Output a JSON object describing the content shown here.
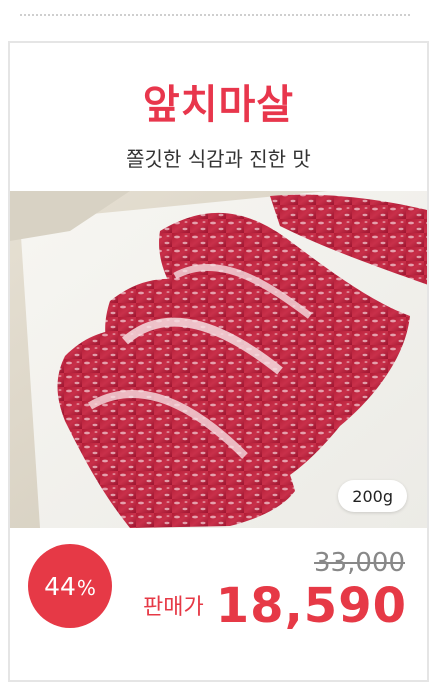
{
  "product": {
    "title": "앞치마살",
    "subtitle": "쫄깃한 식감과 진한 맛",
    "weight": "200g",
    "image_description_icon": "meat-photo"
  },
  "pricing": {
    "discount_value": "44",
    "discount_unit": "%",
    "price_label": "판매가",
    "original_price": "33,000",
    "sale_price": "18,590"
  },
  "colors": {
    "accent": "#e63946",
    "title": "#e8364c",
    "border": "#e5e5e5"
  }
}
